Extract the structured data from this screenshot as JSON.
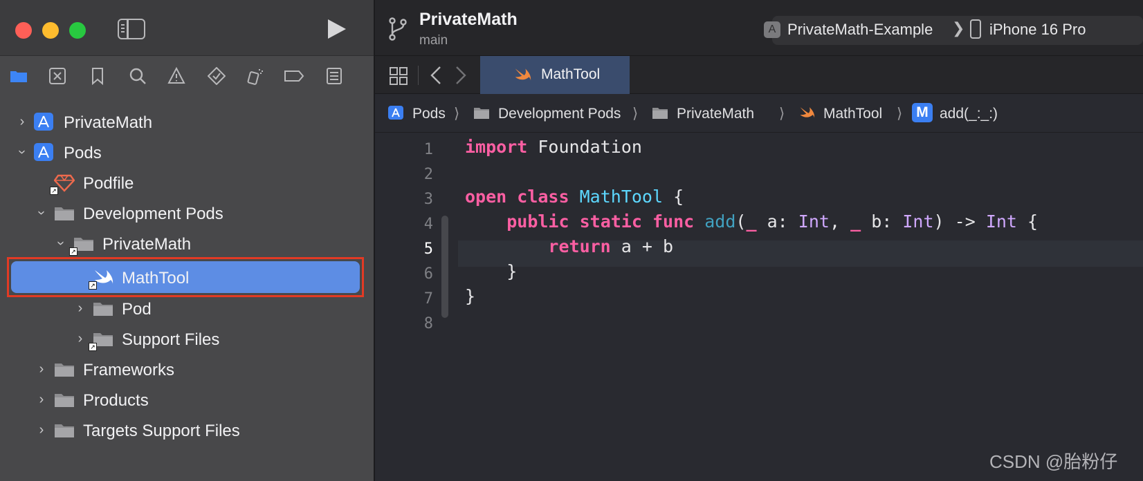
{
  "window": {
    "traffic_lights": [
      "close",
      "minimize",
      "zoom"
    ]
  },
  "toolbar": {
    "project_title": "PrivateMath",
    "branch": "main",
    "scheme_target": "PrivateMath-Example",
    "scheme_separator": "❯",
    "device": "iPhone 16 Pro"
  },
  "navigator": {
    "icons": [
      "folder-icon",
      "source-control-icon",
      "bookmark-icon",
      "search-icon",
      "warning-icon",
      "test-icon",
      "debug-icon",
      "breakpoint-icon",
      "report-icon"
    ],
    "tree": [
      {
        "label": "PrivateMath",
        "icon": "xcode-project-icon",
        "expanded": false
      },
      {
        "label": "Pods",
        "icon": "xcode-project-icon",
        "expanded": true
      },
      {
        "label": "Podfile",
        "icon": "ruby-icon"
      },
      {
        "label": "Development Pods",
        "icon": "folder-icon",
        "expanded": true
      },
      {
        "label": "PrivateMath",
        "icon": "folder-icon",
        "expanded": true
      },
      {
        "label": "MathTool",
        "icon": "swift-icon",
        "selected": true
      },
      {
        "label": "Pod",
        "icon": "folder-icon",
        "expanded": false
      },
      {
        "label": "Support Files",
        "icon": "folder-icon",
        "expanded": false
      },
      {
        "label": "Frameworks",
        "icon": "folder-icon",
        "expanded": false
      },
      {
        "label": "Products",
        "icon": "folder-icon",
        "expanded": false
      },
      {
        "label": "Targets Support Files",
        "icon": "folder-icon",
        "expanded": false
      }
    ]
  },
  "editor": {
    "tab_label": "MathTool",
    "breadcrumb": [
      "Pods",
      "Development Pods",
      "PrivateMath",
      "MathTool",
      "add(_:_:)"
    ],
    "breadcrumb_method_badge": "M",
    "line_numbers": [
      "1",
      "2",
      "3",
      "4",
      "5",
      "6",
      "7",
      "8"
    ],
    "current_line": 5,
    "code_lines": [
      "import Foundation",
      "",
      "open class MathTool {",
      "    public static func add(_ a: Int, _ b: Int) -> Int {",
      "        return a + b",
      "    }",
      "}",
      ""
    ]
  },
  "colors": {
    "keyword": "#fc5fa3",
    "type_declaration": "#5dd8ff",
    "function_declaration": "#41a1c0",
    "type_name": "#d0a8ff",
    "selection": "#5d8de4",
    "highlight_outline": "#e23a24"
  },
  "watermark": "CSDN @胎粉仔"
}
